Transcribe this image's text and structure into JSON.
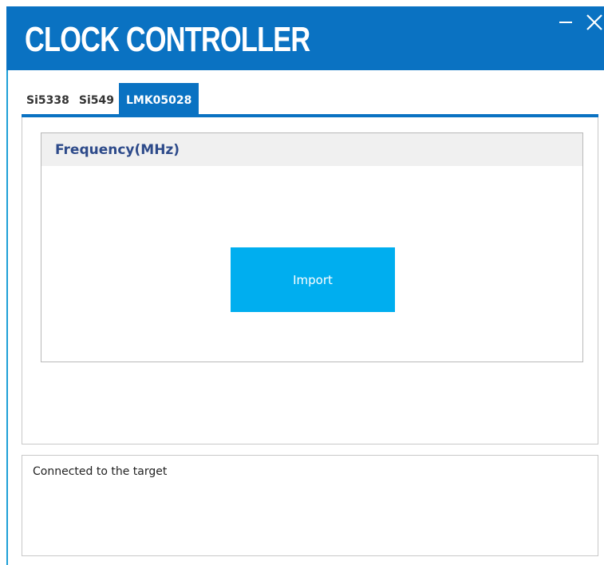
{
  "window": {
    "title": "CLOCK CONTROLLER",
    "minimize_icon": "minimize-icon",
    "close_icon": "close-icon"
  },
  "tabs": [
    {
      "label": "Si5338",
      "active": false
    },
    {
      "label": "Si549",
      "active": false
    },
    {
      "label": "LMK05028",
      "active": true
    }
  ],
  "panel": {
    "group_title": "Frequency(MHz)",
    "import_label": "Import"
  },
  "status": {
    "message": "Connected to the target"
  },
  "colors": {
    "accent": "#0a72c2",
    "button": "#00aeef",
    "group_title": "#2d4a8a"
  }
}
